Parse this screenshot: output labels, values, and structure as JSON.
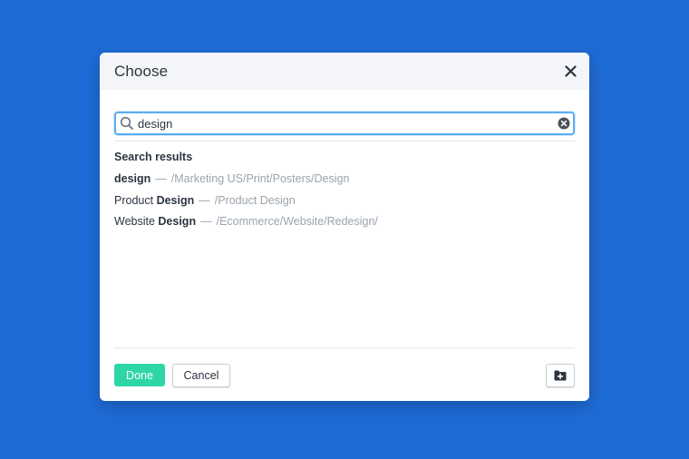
{
  "dialog": {
    "title": "Choose",
    "close_icon": "close-icon"
  },
  "search": {
    "value": "design",
    "placeholder": "",
    "search_icon": "search-icon",
    "clear_icon": "clear-icon"
  },
  "results": {
    "heading": "Search results",
    "items": [
      {
        "prefix": "",
        "match": "design",
        "separator": "—",
        "path": "/Marketing US/Print/Posters/Design"
      },
      {
        "prefix": "Product ",
        "match": "Design",
        "separator": "—",
        "path": "/Product Design"
      },
      {
        "prefix": "Website ",
        "match": "Design",
        "separator": "—",
        "path": "/Ecommerce/Website/Redesign/"
      }
    ]
  },
  "footer": {
    "done_label": "Done",
    "cancel_label": "Cancel",
    "new_folder_icon": "folder-plus-icon"
  },
  "colors": {
    "background": "#1f6bd6",
    "accent": "#2fd6a5",
    "focus": "#5aaef2"
  }
}
